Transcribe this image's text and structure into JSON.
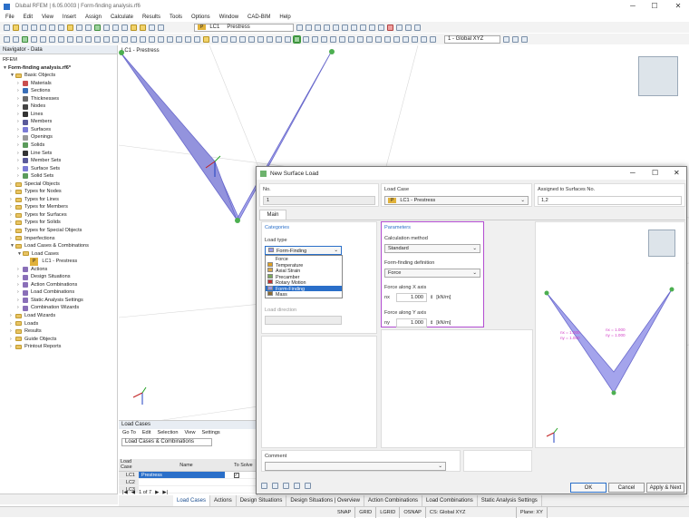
{
  "app": {
    "title": "Dlubal RFEM | 6.05.0003 | Form-finding analysis.rf6"
  },
  "menu": [
    "File",
    "Edit",
    "View",
    "Insert",
    "Assign",
    "Calculate",
    "Results",
    "Tools",
    "Options",
    "Window",
    "CAD-BIM",
    "Help"
  ],
  "toolbar": {
    "lc_badge": "P",
    "lc_code": "LC1",
    "lc_name": "Prestress",
    "cs": "1 - Global XYZ"
  },
  "navigator": {
    "title": "Navigator - Data",
    "root": "RFEM",
    "project": "Form-finding analysis.rf6*",
    "items": [
      {
        "label": "Basic Objects",
        "level": 1,
        "type": "folder",
        "open": true
      },
      {
        "label": "Materials",
        "level": 2,
        "type": "mat"
      },
      {
        "label": "Sections",
        "level": 2,
        "type": "sec"
      },
      {
        "label": "Thicknesses",
        "level": 2,
        "type": "thk"
      },
      {
        "label": "Nodes",
        "level": 2,
        "type": "node"
      },
      {
        "label": "Lines",
        "level": 2,
        "type": "line"
      },
      {
        "label": "Members",
        "level": 2,
        "type": "mem"
      },
      {
        "label": "Surfaces",
        "level": 2,
        "type": "surf"
      },
      {
        "label": "Openings",
        "level": 2,
        "type": "open"
      },
      {
        "label": "Solids",
        "level": 2,
        "type": "solid"
      },
      {
        "label": "Line Sets",
        "level": 2,
        "type": "line"
      },
      {
        "label": "Member Sets",
        "level": 2,
        "type": "mem"
      },
      {
        "label": "Surface Sets",
        "level": 2,
        "type": "surf"
      },
      {
        "label": "Solid Sets",
        "level": 2,
        "type": "solid"
      },
      {
        "label": "Special Objects",
        "level": 1,
        "type": "folder"
      },
      {
        "label": "Types for Nodes",
        "level": 1,
        "type": "folder"
      },
      {
        "label": "Types for Lines",
        "level": 1,
        "type": "folder"
      },
      {
        "label": "Types for Members",
        "level": 1,
        "type": "folder"
      },
      {
        "label": "Types for Surfaces",
        "level": 1,
        "type": "folder"
      },
      {
        "label": "Types for Solids",
        "level": 1,
        "type": "folder"
      },
      {
        "label": "Types for Special Objects",
        "level": 1,
        "type": "folder"
      },
      {
        "label": "Imperfections",
        "level": 1,
        "type": "folder"
      },
      {
        "label": "Load Cases & Combinations",
        "level": 1,
        "type": "folder",
        "open": true
      },
      {
        "label": "Load Cases",
        "level": 2,
        "type": "folder",
        "open": true
      },
      {
        "label": "LC1 - Prestress",
        "level": 3,
        "type": "lc"
      },
      {
        "label": "Actions",
        "level": 2,
        "type": "act"
      },
      {
        "label": "Design Situations",
        "level": 2,
        "type": "act"
      },
      {
        "label": "Action Combinations",
        "level": 2,
        "type": "act"
      },
      {
        "label": "Load Combinations",
        "level": 2,
        "type": "act"
      },
      {
        "label": "Static Analysis Settings",
        "level": 2,
        "type": "act"
      },
      {
        "label": "Combination Wizards",
        "level": 2,
        "type": "act"
      },
      {
        "label": "Load Wizards",
        "level": 1,
        "type": "folder"
      },
      {
        "label": "Loads",
        "level": 1,
        "type": "folder"
      },
      {
        "label": "Results",
        "level": 1,
        "type": "folder"
      },
      {
        "label": "Guide Objects",
        "level": 1,
        "type": "folder"
      },
      {
        "label": "Printout Reports",
        "level": 1,
        "type": "folder"
      }
    ]
  },
  "viewport": {
    "label": "LC1 - Prestress"
  },
  "loadcases": {
    "title": "Load Cases",
    "menu": [
      "Go To",
      "Edit",
      "Selection",
      "View",
      "Settings"
    ],
    "combo": "Load Cases & Combinations",
    "col_lc": "Load Case",
    "col_name": "Name",
    "col_solve": "To Solve",
    "rows": [
      {
        "lc": "LC1",
        "name": "Prestress"
      },
      {
        "lc": "LC2",
        "name": ""
      },
      {
        "lc": "LC3",
        "name": ""
      }
    ],
    "pager": "1 of 7"
  },
  "bottom_tabs": [
    "Load Cases",
    "Actions",
    "Design Situations",
    "Design Situations | Overview",
    "Action Combinations",
    "Load Combinations",
    "Static Analysis Settings"
  ],
  "status": [
    "SNAP",
    "GRID",
    "LGRID",
    "OSNAP",
    "CS: Global XYZ",
    "Plane: XY"
  ],
  "dialog": {
    "title": "New Surface Load",
    "no_label": "No.",
    "no_value": "1",
    "lc_label": "Load Case",
    "lc_badge": "P",
    "lc_value": "LC1 - Prestress",
    "assigned_label": "Assigned to Surfaces No.",
    "assigned_value": "1,2",
    "tab": "Main",
    "categories": "Categories",
    "load_type_label": "Load type",
    "load_type_value": "Form-Finding",
    "load_type_options": [
      "Force",
      "Temperature",
      "Axial Strain",
      "Precamber",
      "Rotary Motion",
      "Form-Finding",
      "Mass"
    ],
    "load_direction": "Load direction",
    "parameters": "Parameters",
    "calc_method_label": "Calculation method",
    "calc_method_value": "Standard",
    "ff_def_label": "Form-finding definition",
    "ff_def_value": "Force",
    "fx_label": "Force along X axis",
    "fx_sym": "nx",
    "fx_value": "1.000",
    "fx_unit": "[kN/m]",
    "fy_label": "Force along Y axis",
    "fy_sym": "ny",
    "fy_value": "1.000",
    "fy_unit": "[kN/m]",
    "comment": "Comment",
    "preview_labels": [
      "nx = 1.000",
      "ny = 1.000",
      "nx = 1.000",
      "ny = 1.000"
    ],
    "ok": "OK",
    "cancel": "Cancel",
    "apply_next": "Apply & Next"
  },
  "colors": {
    "surface": "#9a9ae6",
    "accent": "#2a6fc9",
    "highlight": "#b24cd1",
    "nav_sel": "#cce4f7"
  }
}
